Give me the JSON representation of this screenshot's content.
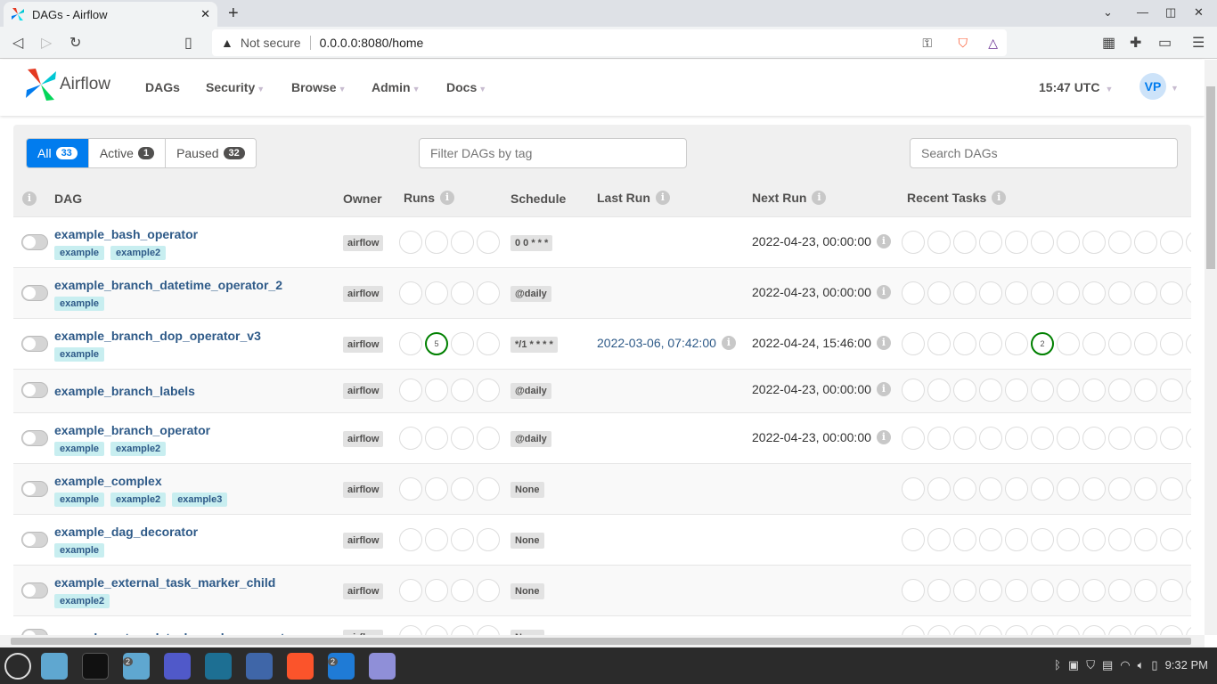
{
  "browser": {
    "tab_title": "DAGs - Airflow",
    "not_secure": "Not secure",
    "url": "0.0.0.0:8080/home"
  },
  "nav": {
    "brand": "Airflow",
    "menus": [
      "DAGs",
      "Security",
      "Browse",
      "Admin",
      "Docs"
    ],
    "clock": "15:47 UTC",
    "avatar": "VP"
  },
  "filters": {
    "all": "All",
    "all_count": "33",
    "active": "Active",
    "active_count": "1",
    "paused": "Paused",
    "paused_count": "32"
  },
  "tag_filter_placeholder": "Filter DAGs by tag",
  "search_placeholder": "Search DAGs",
  "columns": {
    "dag": "DAG",
    "owner": "Owner",
    "runs": "Runs",
    "schedule": "Schedule",
    "last_run": "Last Run",
    "next_run": "Next Run",
    "recent_tasks": "Recent Tasks"
  },
  "colors": {
    "accent": "#017cee",
    "success": "#008000",
    "link": "#2e5a88",
    "tag_bg": "#c8eef0"
  },
  "dags": [
    {
      "name": "example_bash_operator",
      "tags": [
        "example",
        "example2"
      ],
      "owner": "airflow",
      "schedule": "0 0 * * *",
      "last_run": "",
      "next_run": "2022-04-23, 00:00:00",
      "runs": {},
      "tasks": {}
    },
    {
      "name": "example_branch_datetime_operator_2",
      "tags": [
        "example"
      ],
      "owner": "airflow",
      "schedule": "@daily",
      "last_run": "",
      "next_run": "2022-04-23, 00:00:00",
      "runs": {},
      "tasks": {}
    },
    {
      "name": "example_branch_dop_operator_v3",
      "tags": [
        "example"
      ],
      "owner": "airflow",
      "schedule": "*/1 * * * *",
      "last_run": "2022-03-06, 07:42:00",
      "next_run": "2022-04-24, 15:46:00",
      "runs": {
        "1": "5"
      },
      "tasks": {
        "5": "2"
      }
    },
    {
      "name": "example_branch_labels",
      "tags": [],
      "owner": "airflow",
      "schedule": "@daily",
      "last_run": "",
      "next_run": "2022-04-23, 00:00:00",
      "runs": {},
      "tasks": {}
    },
    {
      "name": "example_branch_operator",
      "tags": [
        "example",
        "example2"
      ],
      "owner": "airflow",
      "schedule": "@daily",
      "last_run": "",
      "next_run": "2022-04-23, 00:00:00",
      "runs": {},
      "tasks": {}
    },
    {
      "name": "example_complex",
      "tags": [
        "example",
        "example2",
        "example3"
      ],
      "owner": "airflow",
      "schedule": "None",
      "last_run": "",
      "next_run": "",
      "runs": {},
      "tasks": {}
    },
    {
      "name": "example_dag_decorator",
      "tags": [
        "example"
      ],
      "owner": "airflow",
      "schedule": "None",
      "last_run": "",
      "next_run": "",
      "runs": {},
      "tasks": {}
    },
    {
      "name": "example_external_task_marker_child",
      "tags": [
        "example2"
      ],
      "owner": "airflow",
      "schedule": "None",
      "last_run": "",
      "next_run": "",
      "runs": {},
      "tasks": {}
    },
    {
      "name": "example_external_task_marker_parent",
      "tags": [],
      "owner": "airflow",
      "schedule": "None",
      "last_run": "",
      "next_run": "",
      "runs": {},
      "tasks": {}
    }
  ],
  "taskbar": {
    "time": "9:32 PM",
    "files_badge": "2",
    "vscode_badge": "2"
  }
}
